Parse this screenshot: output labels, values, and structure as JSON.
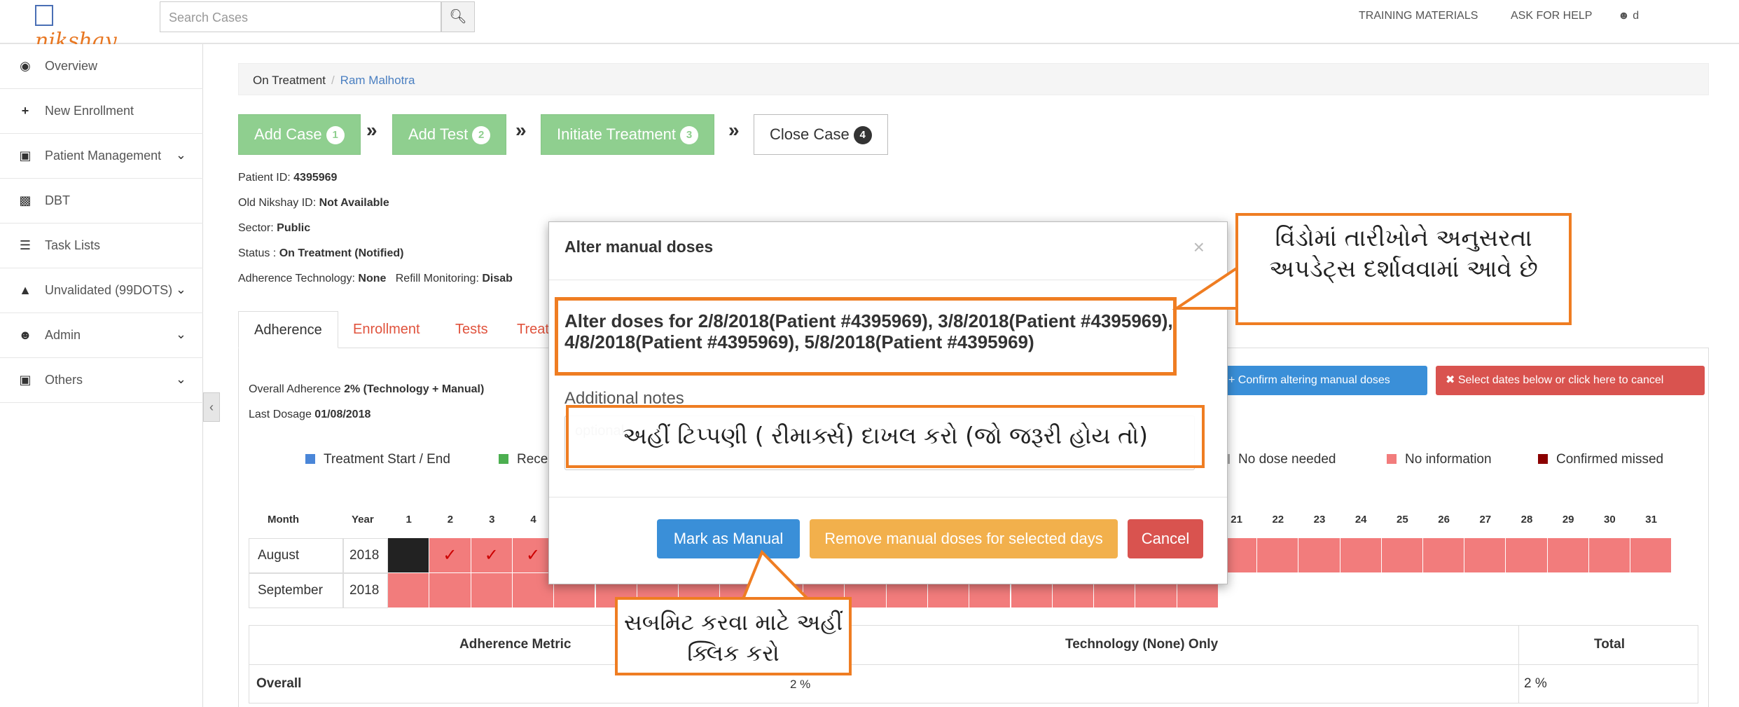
{
  "header": {
    "brand": "nikshay",
    "search_placeholder": "Search Cases",
    "links": [
      "TRAINING MATERIALS",
      "ASK FOR HELP"
    ],
    "user": "d"
  },
  "sidebar": {
    "items": [
      {
        "label": "Overview",
        "icon": "dashboard-icon",
        "chevron": false
      },
      {
        "label": "New Enrollment",
        "icon": "plus-icon",
        "chevron": false
      },
      {
        "label": "Patient Management",
        "icon": "camera-icon",
        "chevron": true
      },
      {
        "label": "DBT",
        "icon": "money-icon",
        "chevron": false
      },
      {
        "label": "Task Lists",
        "icon": "list-icon",
        "chevron": false
      },
      {
        "label": "Unvalidated (99DOTS)",
        "icon": "warning-icon",
        "chevron": true
      },
      {
        "label": "Admin",
        "icon": "user-icon",
        "chevron": true
      },
      {
        "label": "Others",
        "icon": "camera-icon",
        "chevron": true
      }
    ]
  },
  "breadcrumb": {
    "parent": "On Treatment",
    "separator": "/",
    "current": "Ram Malhotra"
  },
  "steps": [
    {
      "label": "Add Case",
      "num": "1"
    },
    {
      "label": "Add Test",
      "num": "2"
    },
    {
      "label": "Initiate Treatment",
      "num": "3"
    },
    {
      "label": "Close Case",
      "num": "4"
    }
  ],
  "patient": {
    "id_label": "Patient ID:",
    "id": "4395969",
    "old_label": "Old Nikshay ID:",
    "old": "Not Available",
    "sector_label": "Sector:",
    "sector": "Public",
    "status_label": "Status :",
    "status": "On Treatment (Notified)",
    "tech_label": "Adherence Technology:",
    "tech": "None",
    "refill_label": "Refill Monitoring:",
    "refill": "Disab"
  },
  "tabs": [
    "Adherence",
    "Enrollment",
    "Tests",
    "Treat"
  ],
  "adherence": {
    "overall_label": "Overall Adherence",
    "overall": "2% (Technology + Manual)",
    "last_label": "Last Dosage",
    "last": "01/08/2018"
  },
  "legend": [
    {
      "label": "Treatment Start / End",
      "color": "#4a86d8"
    },
    {
      "label": "Rece",
      "color": "#4caf50"
    },
    {
      "label": "No dose needed",
      "color": "#aaaaaa"
    },
    {
      "label": "No information",
      "color": "#f27c7c"
    },
    {
      "label": "Confirmed missed",
      "color": "#8b0000"
    }
  ],
  "calendar": {
    "month_header": "Month",
    "year_header": "Year",
    "days_left": [
      "1",
      "2",
      "3",
      "4"
    ],
    "days_right": [
      "21",
      "22",
      "23",
      "24",
      "25",
      "26",
      "27",
      "28",
      "29",
      "30",
      "31"
    ],
    "rows": [
      {
        "month": "August",
        "year": "2018",
        "tick": "✓"
      },
      {
        "month": "September",
        "year": "2018"
      }
    ]
  },
  "buttons_behind": {
    "confirm": "Confirm altering manual doses",
    "cancel_sel": "Select dates below or click here to cancel"
  },
  "metric_table": {
    "headers": [
      "Adherence Metric",
      "Technology (None) Only",
      "Total"
    ],
    "row_label": "Overall",
    "values": [
      "2 %",
      "2 %"
    ]
  },
  "modal": {
    "title": "Alter manual doses",
    "close": "×",
    "alter_text": "Alter doses for 2/8/2018(Patient #4395969), 3/8/2018(Patient #4395969), 4/8/2018(Patient #4395969), 5/8/2018(Patient #4395969)",
    "notes_label": "Additional notes",
    "notes_placeholder": "optional",
    "mark_manual": "Mark as Manual",
    "remove_manual": "Remove manual doses for selected days",
    "cancel": "Cancel"
  },
  "callouts": {
    "top_right": "વિંડોમાં તારીખોને અનુસરતા અપડેટ્સ દર્શાવવામાં આવે છે",
    "notes": "અહીં ટિપ્પણી ( રીમાર્ક્સ) દાખલ કરો (જો જરૂરી હોય તો)",
    "submit": "સબમિટ કરવા માટે અહીં ક્લિક કરો"
  }
}
